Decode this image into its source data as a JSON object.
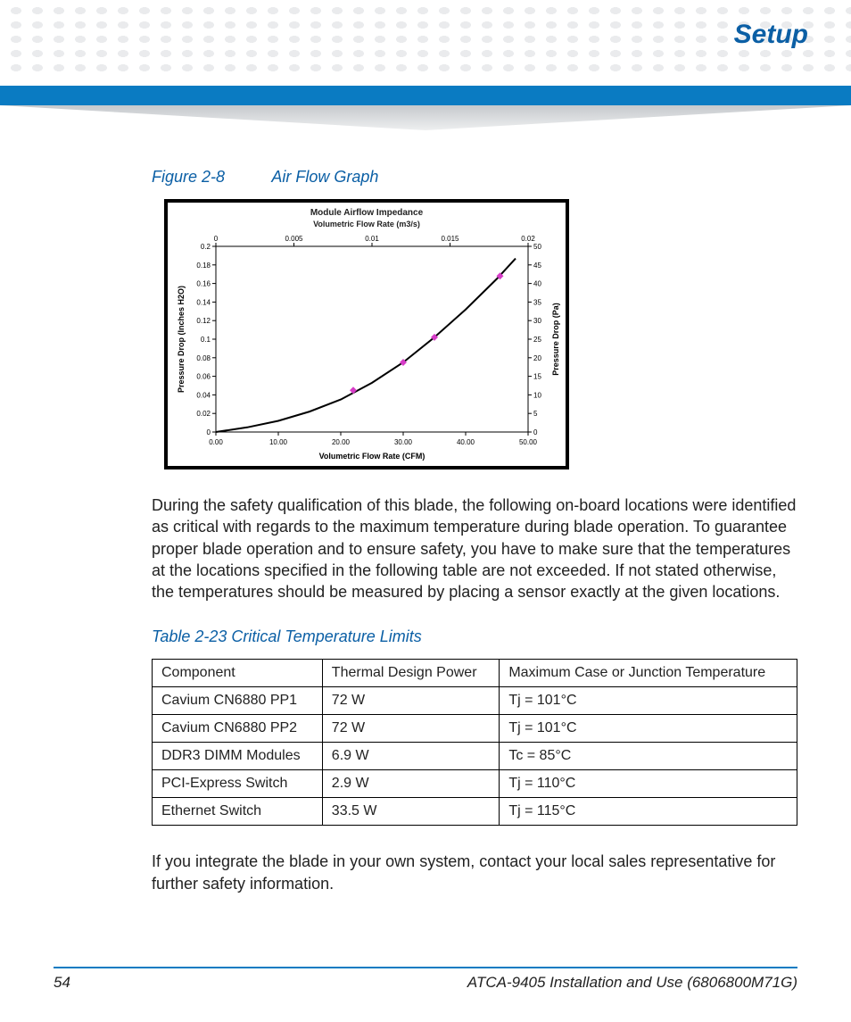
{
  "header": {
    "section": "Setup"
  },
  "figure": {
    "label_num": "Figure 2-8",
    "label_title": "Air Flow Graph",
    "chart_title": "Module Airflow Impedance",
    "chart_subtitle": "Volumetric Flow Rate (m3/s)",
    "x_label": "Volumetric Flow Rate (CFM)",
    "y_left_label": "Pressure Drop (Inches H2O)",
    "y_right_label": "Pressure Drop (Pa)"
  },
  "chart_data": {
    "type": "line",
    "title": "Module Airflow Impedance",
    "xlabel": "Volumetric Flow Rate (CFM)",
    "ylabel": "Pressure Drop (Inches H2O)",
    "xlim": [
      0,
      50
    ],
    "ylim": [
      0,
      0.2
    ],
    "x_ticks": [
      0,
      10,
      20,
      30,
      40,
      50
    ],
    "y_ticks_left": [
      0,
      0.02,
      0.04,
      0.06,
      0.08,
      0.1,
      0.12,
      0.14,
      0.16,
      0.18,
      0.2
    ],
    "x2_label": "Volumetric Flow Rate (m3/s)",
    "x2_ticks": [
      0,
      0.005,
      0.01,
      0.015,
      0.02
    ],
    "y2_label": "Pressure Drop (Pa)",
    "y2_ticks": [
      0,
      5,
      10,
      15,
      20,
      25,
      30,
      35,
      40,
      45,
      50
    ],
    "series": [
      {
        "name": "curve",
        "x": [
          0,
          5,
          10,
          15,
          20,
          25,
          30,
          35,
          40,
          45,
          48
        ],
        "y_left": [
          0,
          0.005,
          0.012,
          0.022,
          0.035,
          0.053,
          0.075,
          0.102,
          0.132,
          0.165,
          0.187
        ]
      }
    ],
    "markers": {
      "x": [
        22,
        30,
        35,
        45.5
      ],
      "y_left": [
        0.045,
        0.075,
        0.102,
        0.168
      ]
    }
  },
  "paragraphs": {
    "p1": "During the safety qualification of this blade, the following on-board locations were identified as critical with regards to the maximum temperature during blade operation. To guarantee proper blade operation and to ensure safety, you have to make sure that the temperatures at the locations specified in the following table are not exceeded. If not stated otherwise, the temperatures should be measured by placing a sensor exactly at the given locations.",
    "p2": "If you integrate the blade in your own system, contact your local sales representative for further safety information."
  },
  "table": {
    "caption": "Table 2-23 Critical Temperature Limits",
    "headers": [
      "Component",
      "Thermal Design Power",
      "Maximum Case or Junction Temperature"
    ],
    "rows": [
      [
        "Cavium CN6880 PP1",
        "72 W",
        "Tj = 101°C"
      ],
      [
        "Cavium CN6880 PP2",
        "72 W",
        "Tj = 101°C"
      ],
      [
        "DDR3 DIMM Modules",
        "6.9 W",
        "Tc = 85°C"
      ],
      [
        "PCI-Express Switch",
        "2.9 W",
        "Tj = 110°C"
      ],
      [
        "Ethernet Switch",
        "33.5 W",
        "Tj = 115°C"
      ]
    ]
  },
  "footer": {
    "page": "54",
    "docid": "ATCA-9405 Installation and Use (6806800M71G)"
  }
}
